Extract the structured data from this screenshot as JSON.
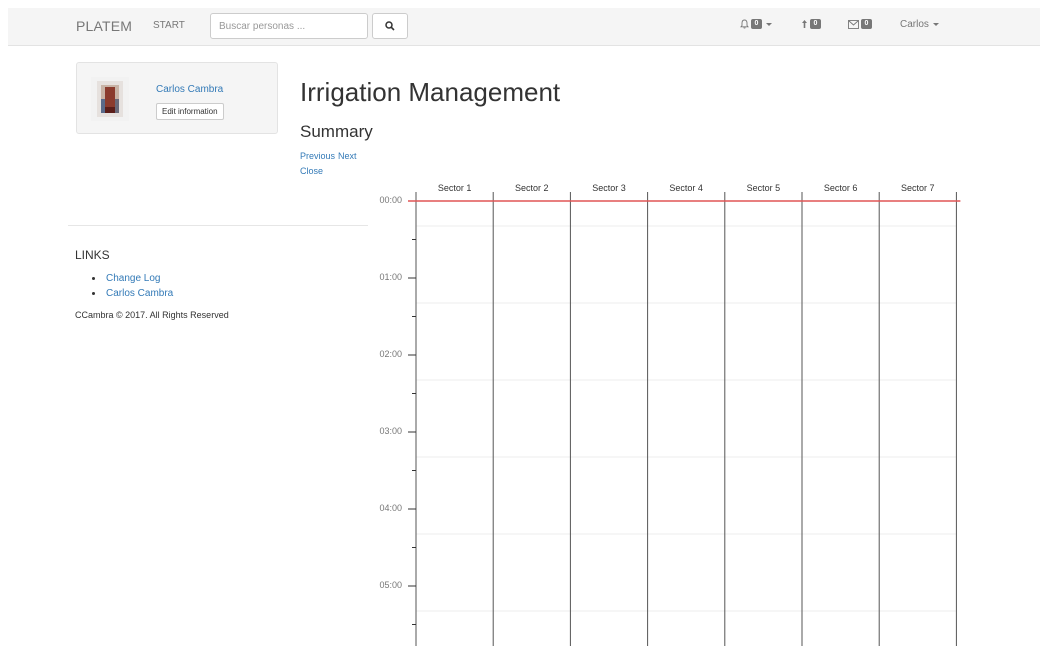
{
  "navbar": {
    "brand": "PLATEM",
    "start": "START",
    "search_placeholder": "Buscar personas ...",
    "search_icon": "search-icon",
    "notifications_count": "0",
    "upload_count": "0",
    "messages_count": "0",
    "user_menu": "Carlos"
  },
  "profile": {
    "name": "Carlos Cambra",
    "edit_label": "Edit information"
  },
  "links": {
    "title": "LINKS",
    "items": [
      "Change Log",
      "Carlos Cambra"
    ]
  },
  "footer": "CCambra © 2017. All Rights Reserved",
  "main": {
    "title": "Irrigation Management",
    "subtitle": "Summary",
    "previous": "Previous",
    "next": "Next",
    "close": "Close"
  },
  "schedule": {
    "sectors": [
      "Sector 1",
      "Sector 2",
      "Sector 3",
      "Sector 4",
      "Sector 5",
      "Sector 6",
      "Sector 7"
    ],
    "times": [
      "00:00",
      "01:00",
      "02:00",
      "03:00",
      "04:00",
      "05:00"
    ],
    "current_time": "00:00",
    "current_time_color": "#e05555",
    "link_color": "#337ab7"
  }
}
